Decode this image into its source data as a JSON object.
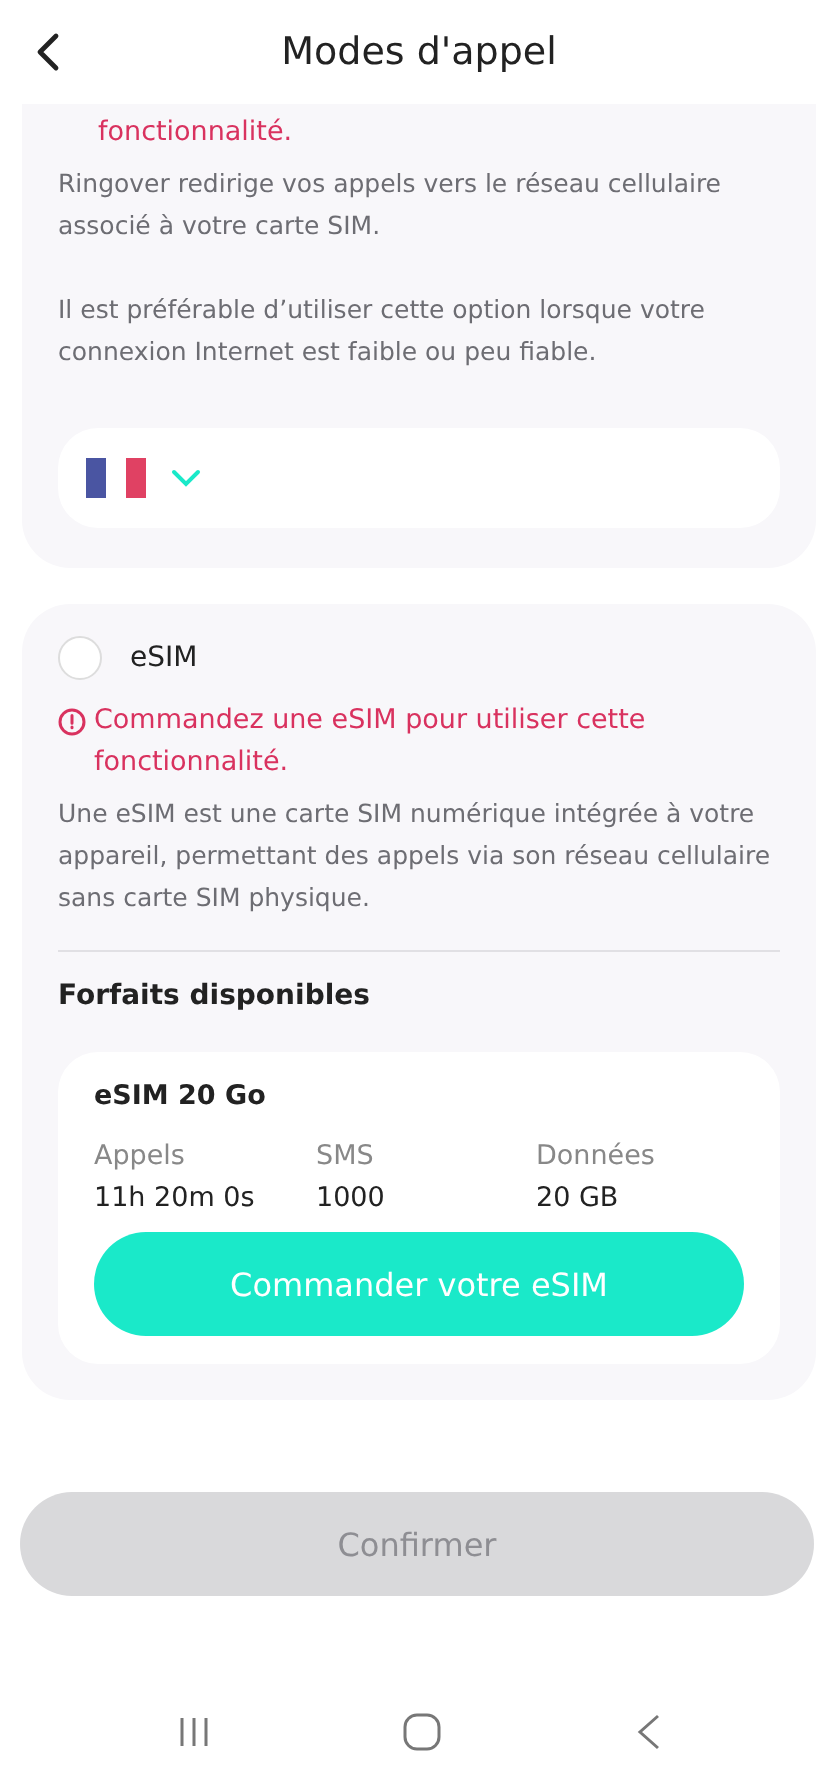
{
  "header": {
    "title": "Modes d'appel"
  },
  "sim_card": {
    "warning_tail": "fonctionnalité.",
    "paragraphs": [
      "Ringover redirige vos appels vers le réseau cellulaire associé à votre carte SIM.",
      "Il est préférable d’utiliser cette option lorsque votre connexion Internet est faible ou peu fiable."
    ]
  },
  "esim_card": {
    "option": {
      "label": "eSIM",
      "selected": false
    },
    "warning": "Commandez une eSIM pour utiliser cette fonctionnalité.",
    "description": "Une eSIM est une carte SIM numérique intégrée à votre appareil, permettant des appels via son réseau cellulaire sans carte SIM physique.",
    "plans_title": "Forfaits disponibles",
    "plans": [
      {
        "name": "eSIM 20 Go",
        "stats": [
          {
            "label": "Appels",
            "value": "11h 20m 0s"
          },
          {
            "label": "SMS",
            "value": "1000"
          },
          {
            "label": "Données",
            "value": "20 GB"
          }
        ],
        "button": "Commander votre eSIM"
      }
    ]
  },
  "confirm_button": {
    "label": "Confirmer",
    "disabled": true
  }
}
